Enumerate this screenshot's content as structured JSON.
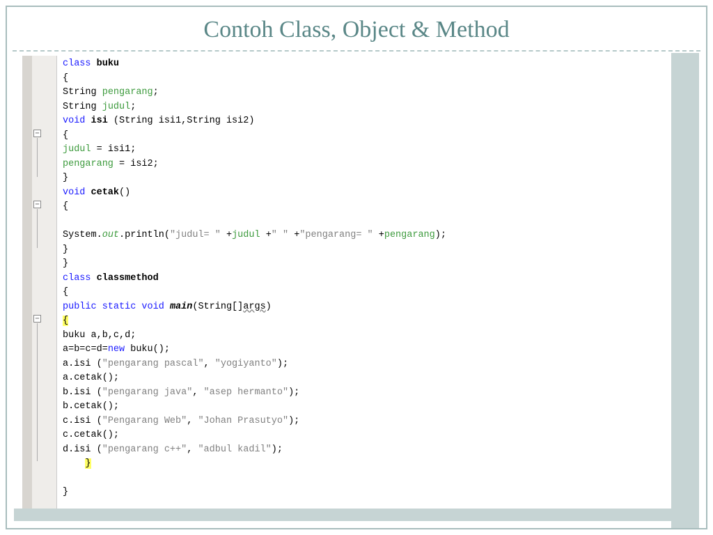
{
  "title": "Contoh Class, Object & Method",
  "code": {
    "l1_kw": "class",
    "l1_name": "buku",
    "l2": "{",
    "l3_type": "String ",
    "l3_ident": "pengarang",
    "l3_end": ";",
    "l4_type": "String ",
    "l4_ident": "judul",
    "l4_end": ";",
    "l5_kw": "void",
    "l5_name": " isi ",
    "l5_sig": "(String isi1,String isi2)",
    "l6": "{",
    "l7_lhs": "judul",
    "l7_op": " = ",
    "l7_rhs": "isi1",
    "l7_end": ";",
    "l8_lhs": "pengarang",
    "l8_op": " = ",
    "l8_rhs": "isi2",
    "l8_end": ";",
    "l9": "}",
    "l10_kw": "void",
    "l10_name": " cetak",
    "l10_sig": "()",
    "l11": "{",
    "l12_blank": " ",
    "l13_a": "System.",
    "l13_out": "out",
    "l13_b": ".println(",
    "l13_s1": "\"judul= \"",
    "l13_c": " +",
    "l13_j": "judul",
    "l13_d": " +",
    "l13_s2": "\" \"",
    "l13_e": " +",
    "l13_s3": "\"pengarang= \"",
    "l13_f": " +",
    "l13_p": "pengarang",
    "l13_g": ");",
    "l14": "}",
    "l15": "}",
    "l16_kw": "class",
    "l16_name": "classmethod",
    "l17": "{",
    "l18_kw": "public static void ",
    "l18_main": "main",
    "l18_sig1": "(String[]",
    "l18_args": "args",
    "l18_sig2": ")",
    "l19": "{",
    "l20": "buku a,b,c,d;",
    "l21_a": "a=b=c=d=",
    "l21_kw": "new",
    "l21_b": " buku();",
    "l22_a": "a.isi (",
    "l22_s1": "\"pengarang pascal\"",
    "l22_b": ", ",
    "l22_s2": "\"yogiyanto\"",
    "l22_c": ");",
    "l23": "a.cetak();",
    "l24_a": "b.isi (",
    "l24_s1": "\"pengarang java\"",
    "l24_b": ", ",
    "l24_s2": "\"asep hermanto\"",
    "l24_c": ");",
    "l25": "b.cetak();",
    "l26_a": "c.isi (",
    "l26_s1": "\"Pengarang Web\"",
    "l26_b": ", ",
    "l26_s2": "\"Johan Prasutyo\"",
    "l26_c": ");",
    "l27": "c.cetak();",
    "l28_a": "d.isi (",
    "l28_s1": "\"pengarang c++\"",
    "l28_b": ", ",
    "l28_s2": "\"adbul kadil\"",
    "l28_c": ");",
    "l29_pad": "    ",
    "l29": "}",
    "l30_blank": " ",
    "l31": "}"
  }
}
